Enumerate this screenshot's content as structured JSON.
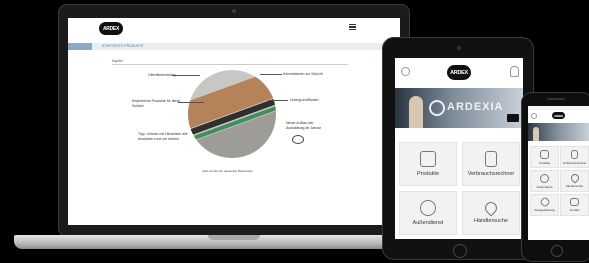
{
  "laptop": {
    "breadcrumb": "STARTSEITE PRODUKTE",
    "section_label": "Kapitel",
    "annotations": {
      "top_left": "Oberflächenbelag",
      "top_right": "Informationen zur Schicht",
      "mid_left": "Empfohlene Produkte für diese Schicht",
      "mid_right": "Untergrund/Boden",
      "lower_left": "Tipp: Zahnen mit Hinweisen alle Ansichten rund um drehen",
      "lower_right": "Neuer Aufbau der Ausstattung ab Januar",
      "caption": "Jetzt suchen für passende Bestenliste"
    }
  },
  "tablet": {
    "banner_text": "ARDEXIA",
    "tiles": [
      "Produkte",
      "Verbrauchsrechner",
      "Außendienst",
      "Händlersuche"
    ]
  },
  "phone": {
    "tiles": [
      "Produkte",
      "Verbrauchsrechner",
      "Außendienst",
      "Händlersuche",
      "Verlegeanleitung",
      "Kontakt"
    ]
  },
  "brand": {
    "logo_text": "ARDEX",
    "accent": "#1a6fb6"
  }
}
